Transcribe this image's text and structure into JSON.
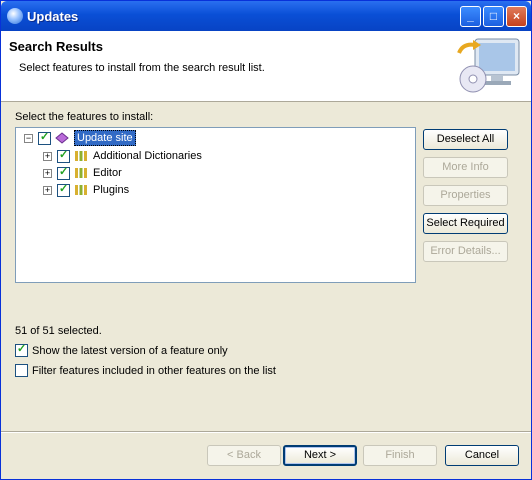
{
  "window": {
    "title": "Updates"
  },
  "header": {
    "title": "Search Results",
    "description": "Select features to install from the search result list.",
    "graphic_icon": "monitor-cd-icon"
  },
  "tree": {
    "label": "Select the features to install:",
    "items": [
      {
        "label": "Update site",
        "checked": true,
        "selected": true,
        "expanded": true,
        "icon": "update-site-icon"
      },
      {
        "label": "Additional Dictionaries",
        "checked": true,
        "expanded": false,
        "icon": "feature-icon"
      },
      {
        "label": "Editor",
        "checked": true,
        "expanded": false,
        "icon": "feature-icon"
      },
      {
        "label": "Plugins",
        "checked": true,
        "expanded": false,
        "icon": "feature-icon"
      }
    ]
  },
  "side_buttons": {
    "deselect_all": "Deselect All",
    "more_info": "More Info",
    "properties": "Properties",
    "select_required": "Select Required",
    "error_details": "Error Details..."
  },
  "status": "51 of 51 selected.",
  "options": {
    "latest_only": {
      "label": "Show the latest version of a feature only",
      "checked": true
    },
    "filter_included": {
      "label": "Filter features included in other features on the list",
      "checked": false
    }
  },
  "nav": {
    "back": "< Back",
    "next": "Next >",
    "finish": "Finish",
    "cancel": "Cancel"
  },
  "colors": {
    "title_bar": "#0a4fd6",
    "selection": "#316ac5",
    "check": "#21a121"
  }
}
